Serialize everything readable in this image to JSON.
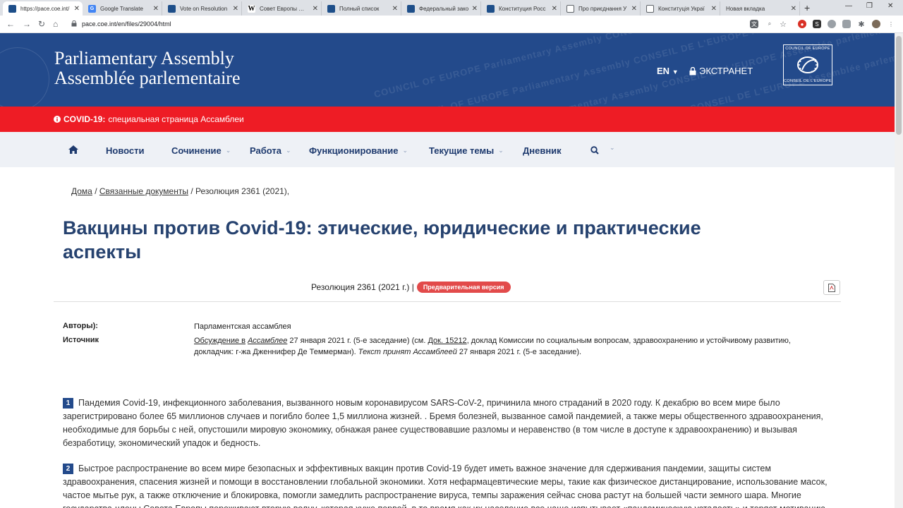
{
  "browser": {
    "tabs": [
      {
        "title": "https://pace.coe.int/",
        "icon": "pace-favicon",
        "active": true
      },
      {
        "title": "Google Translate",
        "icon": "translate-favicon"
      },
      {
        "title": "Vote on Resolution",
        "icon": "coe-favicon"
      },
      {
        "title": "Совет Европы — В",
        "icon": "wikipedia-favicon"
      },
      {
        "title": "Полный список",
        "icon": "coe-favicon"
      },
      {
        "title": "Федеральный зако",
        "icon": "kremlin-favicon"
      },
      {
        "title": "Конституция Росс",
        "icon": "kremlin-favicon"
      },
      {
        "title": "Про приєднання У",
        "icon": "document-favicon"
      },
      {
        "title": "Конституція Украї",
        "icon": "document-favicon"
      },
      {
        "title": "Новая вкладка",
        "icon": "none"
      }
    ],
    "url": "pace.coe.int/en/files/29004/html"
  },
  "header": {
    "title_en": "Parliamentary Assembly",
    "title_fr": "Assemblée parlementaire",
    "lang": "EN",
    "extranet": "ЭКСТРАНЕТ",
    "logo_top": "COUNCIL OF EUROPE",
    "logo_bottom": "CONSEIL DE L'EUROPE",
    "watermark": "COUNCIL OF EUROPE Parliamentary Assembly CONSEIL DE L'EUROPE Assemblée parlementaire"
  },
  "covid": {
    "label": "COVID-19:",
    "text": "специальная страница Ассамблеи"
  },
  "nav": {
    "items": [
      {
        "label": "Новости",
        "dropdown": false
      },
      {
        "label": "Сочинение",
        "dropdown": true
      },
      {
        "label": "Работа",
        "dropdown": true
      },
      {
        "label": "Функционирование",
        "dropdown": true
      },
      {
        "label": "Текущие темы",
        "dropdown": true
      },
      {
        "label": "Дневник",
        "dropdown": false
      }
    ]
  },
  "breadcrumb": {
    "home": "Дома",
    "related": "Связанные документы",
    "current": "Резолюция 2361 (2021),",
    "sep": "/"
  },
  "document": {
    "title": "Вакцины против Covid-19: этические, юридические и практические аспекты",
    "reference": "Резолюция 2361 (2021 г.) |",
    "badge": "Предварительная версия",
    "authors_label": "Авторы):",
    "authors_value": "Парламентская ассамблея",
    "source_label": "Источник",
    "source_p1": "Обсуждение в",
    "source_p2": "Ассамблее",
    "source_p3": "27 января 2021 г. (5-е заседание) (см.",
    "source_link": "Док. 15212",
    "source_p4": ", доклад Комиссии по социальным вопросам, здравоохранению и устойчивому развитию, докладчик: г-жа Дженнифер Де Теммерман).",
    "source_p5": "Текст принят Ассамблеей",
    "source_p6": "27 января 2021 г. (5-е заседание).",
    "paragraphs": [
      {
        "num": "1",
        "text": "Пандемия Covid-19, инфекционного заболевания, вызванного новым коронавирусом SARS-CoV-2, причинила много страданий в 2020 году. К декабрю во всем мире было зарегистрировано более 65 миллионов случаев и погибло более 1,5 миллиона жизней. . Бремя болезней, вызванное самой пандемией, а также меры общественного здравоохранения, необходимые для борьбы с ней, опустошили мировую экономику, обнажая ранее существовавшие разломы и неравенство (в том числе в доступе к здравоохранению) и вызывая безработицу, экономический упадок и бедность."
      },
      {
        "num": "2",
        "text": "Быстрое распространение во всем мире безопасных и эффективных вакцин против Covid-19 будет иметь важное значение для сдерживания пандемии, защиты систем здравоохранения, спасения жизней и помощи в восстановлении глобальной экономики. Хотя нефармацевтические меры, такие как физическое дистанцирование, использование масок, частое мытье рук, а также отключение и блокировка, помогли замедлить распространение вируса, темпы заражения сейчас снова растут на большей части земного шара. Многие государства-члены Совета Европы переживают вторую волну, которая хуже первой, в то время как их население все чаще испытывает «пандемическую усталость» и теряет мотивацию к"
      }
    ]
  },
  "colors": {
    "banner": "#234a8b",
    "covid": "#ee1c25",
    "nav_bg": "#eef1f6",
    "title": "#26426f",
    "badge": "#e24a4a"
  }
}
